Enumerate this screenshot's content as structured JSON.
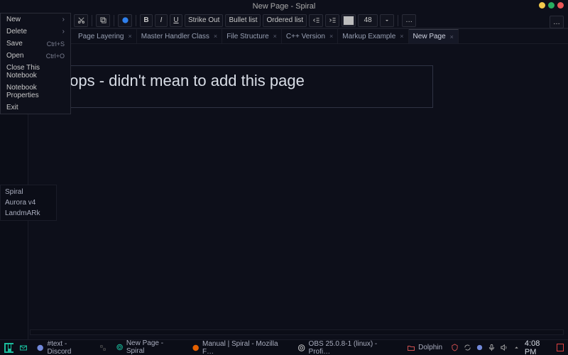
{
  "window": {
    "title": "New Page - Spiral",
    "controls": {
      "min": "#f2c94c",
      "max": "#27ae60",
      "close": "#eb5757"
    }
  },
  "menu": {
    "items": [
      {
        "label": "New",
        "shortcut": "",
        "submenu": true
      },
      {
        "label": "Delete",
        "shortcut": "",
        "submenu": true
      },
      {
        "label": "Save",
        "shortcut": "Ctrl+S",
        "submenu": false
      },
      {
        "label": "Open",
        "shortcut": "Ctrl+O",
        "submenu": false
      },
      {
        "label": "Close This Notebook",
        "shortcut": "",
        "submenu": false
      },
      {
        "label": "Notebook Properties",
        "shortcut": "",
        "submenu": false
      },
      {
        "label": "Exit",
        "shortcut": "",
        "submenu": false
      }
    ]
  },
  "toolbar": {
    "bold": "B",
    "italic": "I",
    "underline": "U",
    "strike": "Strike Out",
    "bullet": "Bullet list",
    "ordered": "Ordered list",
    "font_size": "48",
    "overflow": "…",
    "color": "#bdbdbd"
  },
  "tabs": [
    {
      "label": "Page Layering",
      "active": false
    },
    {
      "label": "Master Handler Class",
      "active": false
    },
    {
      "label": "File Structure",
      "active": false
    },
    {
      "label": "C++ Version",
      "active": false
    },
    {
      "label": "Markup Example",
      "active": false
    },
    {
      "label": "New Page",
      "active": true
    }
  ],
  "editor": {
    "content": "Oops - didn't mean to add this page"
  },
  "projects": [
    "Spiral",
    "Aurora v4",
    "LandmARk"
  ],
  "taskbar": {
    "items": [
      {
        "label": "#text - Discord"
      },
      {
        "label": "New Page - Spiral"
      },
      {
        "label": "Manual | Spiral - Mozilla F…"
      },
      {
        "label": "OBS 25.0.8-1 (linux) - Profi…"
      },
      {
        "label": "Dolphin"
      }
    ],
    "clock": "4:08 PM"
  }
}
